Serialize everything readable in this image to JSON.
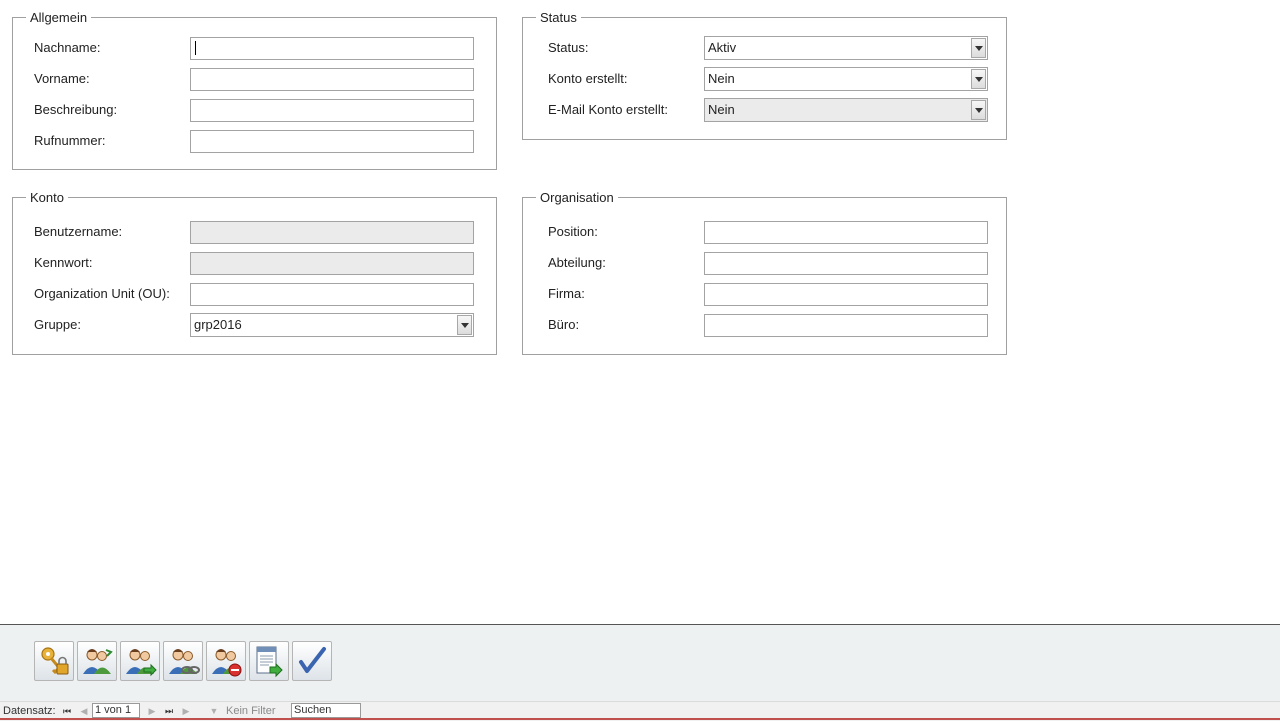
{
  "allgemein": {
    "legend": "Allgemein",
    "nachname_label": "Nachname:",
    "nachname_value": "",
    "vorname_label": "Vorname:",
    "vorname_value": "",
    "beschreibung_label": "Beschreibung:",
    "beschreibung_value": "",
    "rufnummer_label": "Rufnummer:",
    "rufnummer_value": ""
  },
  "status": {
    "legend": "Status",
    "status_label": "Status:",
    "status_value": "Aktiv",
    "konto_label": "Konto erstellt:",
    "konto_value": "Nein",
    "email_label": "E-Mail Konto erstellt:",
    "email_value": "Nein"
  },
  "konto": {
    "legend": "Konto",
    "benutzername_label": "Benutzername:",
    "benutzername_value": "",
    "kennwort_label": "Kennwort:",
    "kennwort_value": "",
    "ou_label": "Organization Unit (OU):",
    "ou_value": "",
    "gruppe_label": "Gruppe:",
    "gruppe_value": "grp2016"
  },
  "organisation": {
    "legend": "Organisation",
    "position_label": "Position:",
    "position_value": "",
    "abteilung_label": "Abteilung:",
    "abteilung_value": "",
    "firma_label": "Firma:",
    "firma_value": "",
    "buero_label": "Büro:",
    "buero_value": ""
  },
  "toolbar": {
    "buttons": [
      "key-lock-icon",
      "user-edit-icon",
      "user-export-icon",
      "user-link-icon",
      "user-remove-icon",
      "document-export-icon",
      "checkmark-icon"
    ]
  },
  "navigation": {
    "record_label": "Datensatz:",
    "record_position": "1 von 1",
    "filter_label": "Kein Filter",
    "search_placeholder": "Suchen"
  },
  "colors": {
    "accent_line": "#c0504d",
    "toolbar_bg": "#eef1f2",
    "disabled_bg": "#ebebeb"
  }
}
